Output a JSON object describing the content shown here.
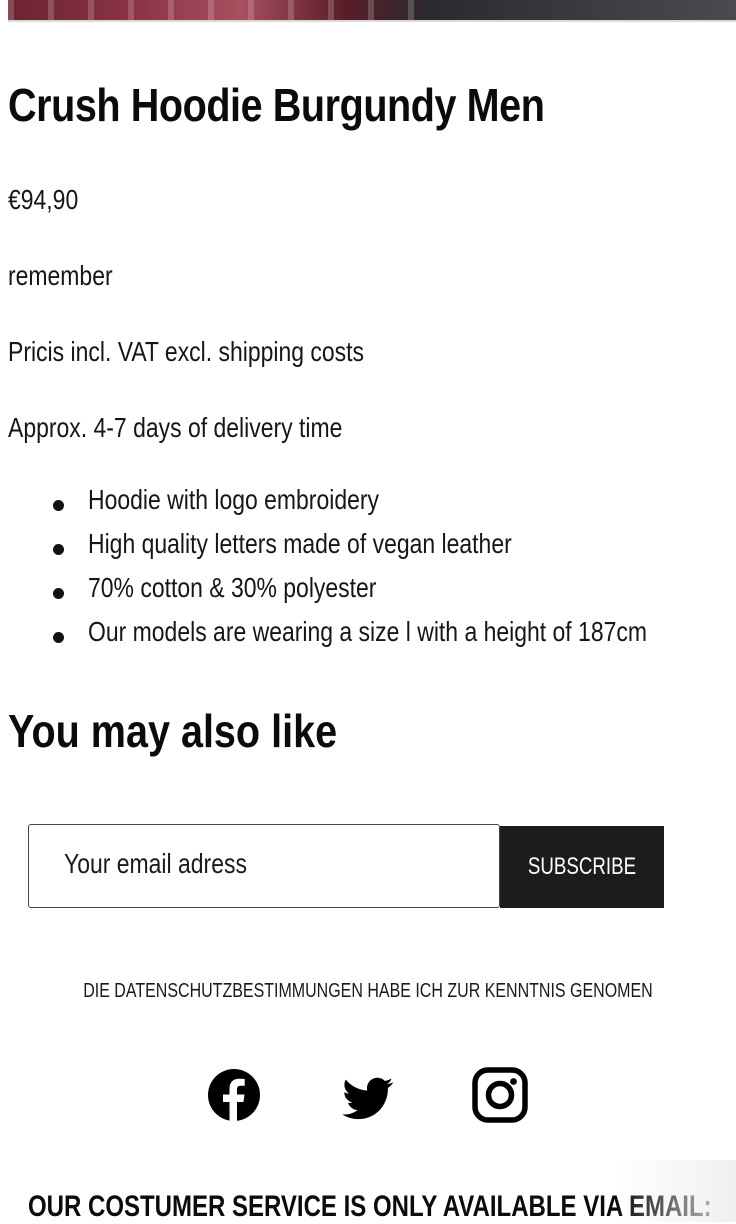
{
  "product": {
    "title": "Crush Hoodie Burgundy Men",
    "price": "€94,90",
    "note": "remember",
    "vat_note": "Pricis incl. VAT excl. shipping costs",
    "delivery": "Approx. 4-7 days of delivery time",
    "features": [
      "Hoodie with logo embroidery",
      "High quality letters made of vegan leather",
      "70% cotton & 30% polyester",
      "Our models are wearing a size l with a height of 187cm"
    ]
  },
  "related": {
    "heading": "You may also like"
  },
  "newsletter": {
    "placeholder": "Your email adress",
    "subscribe_label": "SUBSCRIBE",
    "privacy_text": "DIE DATENSCHUTZBESTIMMUNGEN HABE ICH ZUR KENNTNIS GENOMEN"
  },
  "social": {
    "icons": [
      "facebook-icon",
      "twitter-icon",
      "instagram-icon"
    ]
  },
  "footer": {
    "service_text": "OUR COSTUMER SERVICE IS ONLY AVAILABLE VIA EMAIL:"
  },
  "colors": {
    "text": "#111111",
    "button_bg": "#1c1c1c",
    "button_text": "#ffffff",
    "background": "#ffffff"
  }
}
